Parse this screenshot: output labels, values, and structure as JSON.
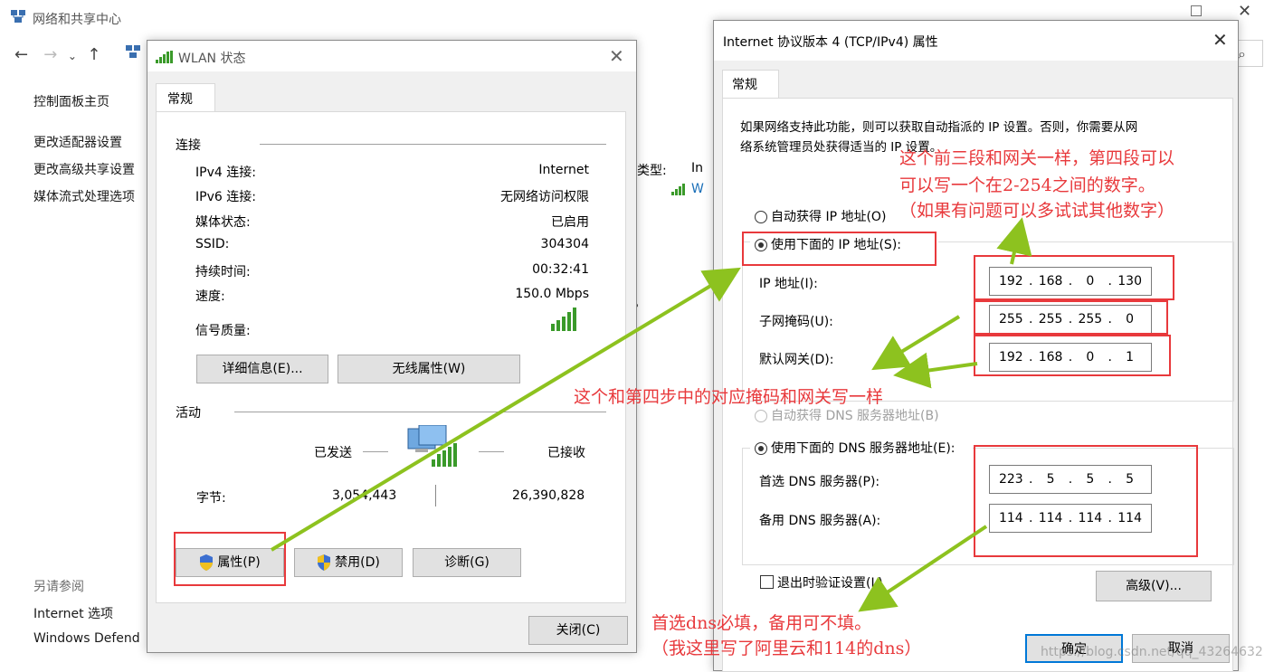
{
  "background_window": {
    "title": "网络和共享中心",
    "sidebar": [
      "控制面板主页",
      "更改适配器设置",
      "更改高级共享设置",
      "媒体流式处理选项"
    ],
    "see_also_label": "另请参阅",
    "see_also": [
      "Internet 选项",
      "Windows Defend"
    ],
    "partial": {
      "type_label": "类型:",
      "type_val": "In",
      "wlan_short": "W",
      "dot": "。"
    }
  },
  "wlan": {
    "title": "WLAN 状态",
    "tab": "常规",
    "connection_group": "连接",
    "rows": [
      {
        "label": "IPv4 连接:",
        "value": "Internet"
      },
      {
        "label": "IPv6 连接:",
        "value": "无网络访问权限"
      },
      {
        "label": "媒体状态:",
        "value": "已启用"
      },
      {
        "label": "SSID:",
        "value": "304304"
      },
      {
        "label": "持续时间:",
        "value": "00:32:41"
      },
      {
        "label": "速度:",
        "value": "150.0 Mbps"
      }
    ],
    "signal_label": "信号质量:",
    "details_button": "详细信息(E)...",
    "wireless_props_button": "无线属性(W)",
    "activity_group": "活动",
    "sent_label": "已发送",
    "received_label": "已接收",
    "bytes_label": "字节:",
    "bytes_sent": "3,054,443",
    "bytes_received": "26,390,828",
    "properties_button": "属性(P)",
    "disable_button": "禁用(D)",
    "diagnose_button": "诊断(G)",
    "close_button": "关闭(C)"
  },
  "tcp": {
    "title": "Internet 协议版本 4 (TCP/IPv4) 属性",
    "tab": "常规",
    "description_line1": "如果网络支持此功能，则可以获取自动指派的 IP 设置。否则，你需要从网",
    "description_line2": "络系统管理员处获得适当的 IP 设置。",
    "auto_ip": "自动获得 IP 地址(O)",
    "manual_ip": "使用下面的 IP 地址(S):",
    "ip_label": "IP 地址(I):",
    "ip": [
      "192",
      "168",
      "0",
      "130"
    ],
    "mask_label": "子网掩码(U):",
    "mask": [
      "255",
      "255",
      "255",
      "0"
    ],
    "gateway_label": "默认网关(D):",
    "gateway": [
      "192",
      "168",
      "0",
      "1"
    ],
    "auto_dns": "自动获得 DNS 服务器地址(B)",
    "manual_dns": "使用下面的 DNS 服务器地址(E):",
    "dns1_label": "首选 DNS 服务器(P):",
    "dns1": [
      "223",
      "5",
      "5",
      "5"
    ],
    "dns2_label": "备用 DNS 服务器(A):",
    "dns2": [
      "114",
      "114",
      "114",
      "114"
    ],
    "validate_label": "退出时验证设置(L)",
    "advanced_button": "高级(V)...",
    "ok_button": "确定",
    "cancel_button": "取消"
  },
  "annotations": {
    "top_line1": "这个前三段和网关一样，第四段可以",
    "top_line2": "可以写一个在2-254之间的数字。",
    "top_line3": "（如果有问题可以多试试其他数字）",
    "middle": "这个和第四步中的对应掩码和网关写一样",
    "bottom_line1": "首选dns必填，备用可不填。",
    "bottom_line2": "（我这里写了阿里云和114的dns）",
    "watermark": "https://blog.csdn.net/qq_43264632"
  },
  "colors": {
    "annotation": "#e8393c",
    "arrow": "#8dc21f",
    "signal": "#3a9a2a"
  }
}
